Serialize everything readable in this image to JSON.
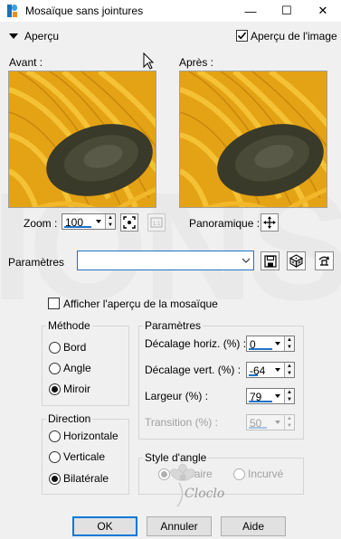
{
  "window": {
    "title": "Mosaïque sans jointures",
    "min": "—",
    "max": "☐",
    "close": "✕"
  },
  "toolbar": {
    "preview_label": "Aperçu",
    "image_preview_label": "Aperçu de l'image",
    "image_preview_checked": true
  },
  "preview": {
    "before_label": "Avant :",
    "after_label": "Après :"
  },
  "zoom": {
    "label": "Zoom :",
    "value": "100",
    "pan_label": "Panoramique :"
  },
  "params": {
    "label": "Paramètres",
    "value": ""
  },
  "mosaic_preview": {
    "label": "Afficher l'aperçu de la mosaïque",
    "checked": false
  },
  "method": {
    "title": "Méthode",
    "options": [
      {
        "label": "Bord",
        "selected": false
      },
      {
        "label": "Angle",
        "selected": false
      },
      {
        "label": "Miroir",
        "selected": true
      }
    ]
  },
  "direction": {
    "title": "Direction",
    "options": [
      {
        "label": "Horizontale",
        "selected": false
      },
      {
        "label": "Verticale",
        "selected": false
      },
      {
        "label": "Bilatérale",
        "selected": true
      }
    ]
  },
  "settings": {
    "title": "Paramètres",
    "h_offset_label": "Décalage horiz. (%) :",
    "h_offset_value": "0",
    "v_offset_label": "Décalage vert. (%) :",
    "v_offset_value": "-64",
    "width_label": "Largeur (%) :",
    "width_value": "79",
    "transition_label": "Transition (%) :",
    "transition_value": "50"
  },
  "corner_style": {
    "title": "Style d'angle",
    "options": [
      {
        "label": "Linéaire",
        "selected": true
      },
      {
        "label": "Incurvé",
        "selected": false
      }
    ]
  },
  "watermark": {
    "text": "Cloclo"
  },
  "buttons": {
    "ok": "OK",
    "cancel": "Annuler",
    "help": "Aide"
  },
  "colors": {
    "accent": "#1e73c8",
    "default_border": "#0078d7"
  }
}
